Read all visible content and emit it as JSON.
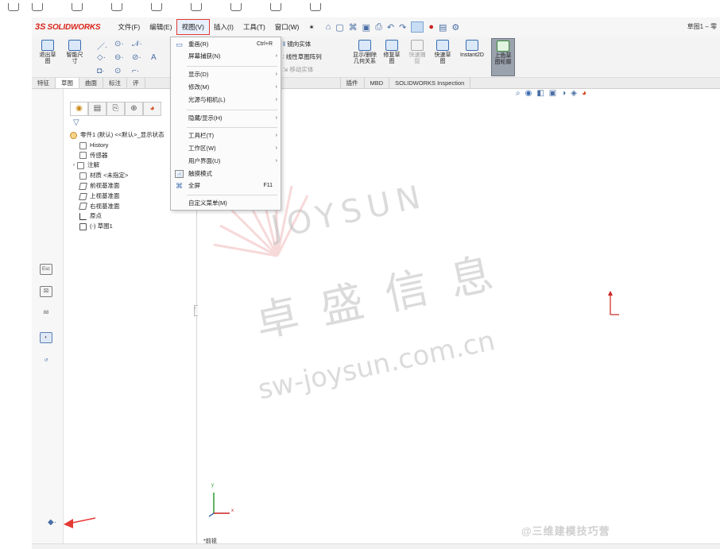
{
  "menubar": {
    "brand_ds": "3S",
    "brand_name": "SOLIDWORKS",
    "items": [
      "文件(F)",
      "编辑(E)",
      "视图(V)",
      "插入(I)",
      "工具(T)",
      "窗口(W)"
    ],
    "doc_title": "草图1 – 零"
  },
  "toolbar": {
    "buttons": [
      {
        "label": "退出草\n图"
      },
      {
        "label": "智能尺\n寸"
      },
      {
        "label": "镜向实体"
      },
      {
        "label": "线性草图阵列"
      },
      {
        "label": "移动实体"
      },
      {
        "label": "显示/删除\n几何关系"
      },
      {
        "label": "修复草\n图"
      },
      {
        "label": "快速捕\n捉"
      },
      {
        "label": "快速草\n图"
      },
      {
        "label": "Instant2D"
      },
      {
        "label": "上色草\n图轮廓"
      }
    ],
    "tabs": [
      "特征",
      "草图",
      "曲面",
      "标注",
      "评",
      "插件",
      "MBD",
      "SOLIDWORKS Inspection"
    ],
    "selected_tab": "草图"
  },
  "view_menu": {
    "items": [
      {
        "label": "重画(R)",
        "shortcut": "Ctrl+R",
        "submenu": false,
        "icon": "redraw-icon"
      },
      {
        "label": "屏幕捕获(N)",
        "shortcut": "",
        "submenu": true,
        "icon": ""
      },
      {
        "label": "显示(D)",
        "shortcut": "",
        "submenu": true,
        "icon": ""
      },
      {
        "label": "修改(M)",
        "shortcut": "",
        "submenu": true,
        "icon": ""
      },
      {
        "label": "光源与相机(L)",
        "shortcut": "",
        "submenu": true,
        "icon": ""
      },
      {
        "label": "隐藏/显示(H)",
        "shortcut": "",
        "submenu": true,
        "icon": ""
      },
      {
        "label": "工具栏(T)",
        "shortcut": "",
        "submenu": true,
        "icon": ""
      },
      {
        "label": "工作区(W)",
        "shortcut": "",
        "submenu": true,
        "icon": ""
      },
      {
        "label": "用户界面(U)",
        "shortcut": "",
        "submenu": true,
        "icon": ""
      },
      {
        "label": "触摸模式",
        "shortcut": "",
        "submenu": false,
        "icon": "touch-mode-icon"
      },
      {
        "label": "全屏",
        "shortcut": "F11",
        "submenu": false,
        "icon": "fullscreen-icon"
      },
      {
        "label": "自定义菜单(M)",
        "shortcut": "",
        "submenu": false,
        "icon": ""
      }
    ]
  },
  "feature_tree": {
    "items": [
      "零件1 (默认) <<默认>_显示状态",
      "History",
      "传感器",
      "注解",
      "材质 <未指定>",
      "前视基准面",
      "上视基准面",
      "右视基准面",
      "原点",
      "(-) 草图1"
    ]
  },
  "graphics": {
    "view_label": "*前视",
    "axis_x": "x",
    "axis_y": "y"
  },
  "watermark": {
    "latin": "JOYSUN",
    "cn": "卓 盛 信 息",
    "url": "sw-joysun.com.cn",
    "credit": "@三维建模技巧营"
  },
  "colors": {
    "accent_red": "#e53935",
    "brand_red": "#d9261c",
    "menu_highlight": "#e8f0fb"
  }
}
